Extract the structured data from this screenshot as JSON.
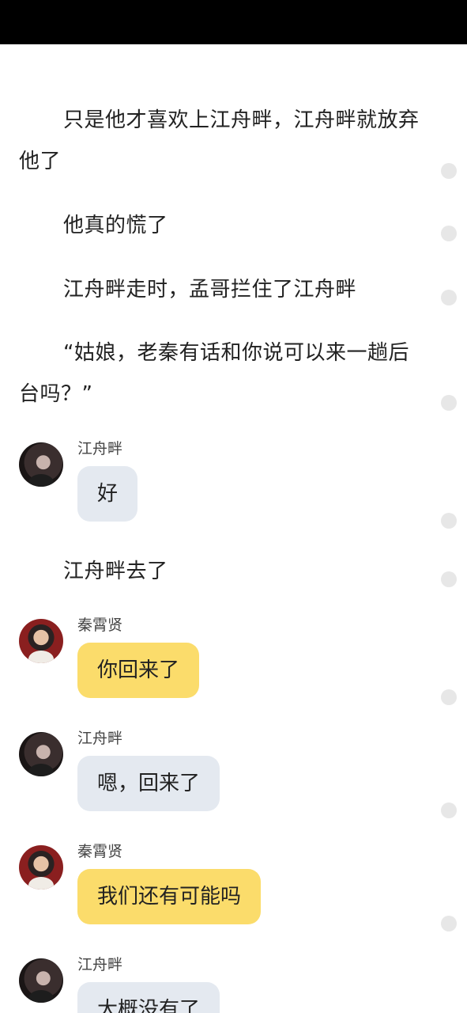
{
  "paragraphs": [
    "只是他才喜欢上江舟畔，江舟畔就放弃他了",
    "他真的慌了",
    "江舟畔走时，孟哥拦住了江舟畔",
    "“姑娘，老秦有话和你说可以来一趟后台吗？”",
    "江舟畔去了"
  ],
  "messages": [
    {
      "name": "江舟畔",
      "text": "好",
      "avatar": "jiang-avatar",
      "bubble_color": "#e4e9f0"
    },
    {
      "name": "秦霄贤",
      "text": "你回来了",
      "avatar": "qin-avatar",
      "bubble_color": "#fbdc6b"
    },
    {
      "name": "江舟畔",
      "text": "嗯，回来了",
      "avatar": "jiang-avatar",
      "bubble_color": "#e4e9f0"
    },
    {
      "name": "秦霄贤",
      "text": "我们还有可能吗",
      "avatar": "qin-avatar",
      "bubble_color": "#fbdc6b"
    },
    {
      "name": "江舟畔",
      "text": "大概没有了",
      "avatar": "jiang-avatar",
      "bubble_color": "#e4e9f0"
    }
  ],
  "colors": {
    "status_bar": "#000000",
    "bubble_gray": "#e4e9f0",
    "bubble_yellow": "#fbdc6b",
    "comment_dot": "#e7e7e7"
  }
}
